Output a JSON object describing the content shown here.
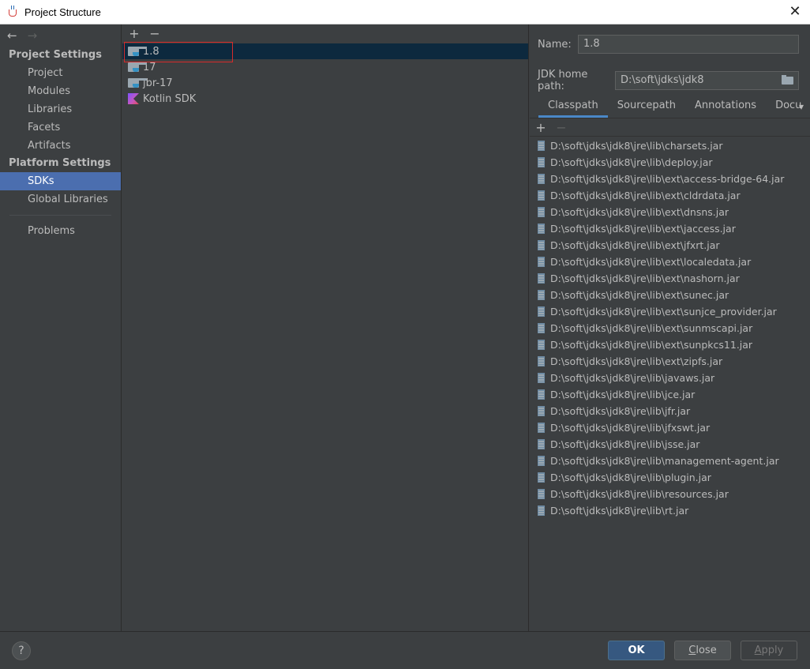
{
  "window": {
    "title": "Project Structure",
    "close_icon": "close-icon"
  },
  "nav": {
    "back_icon": "←",
    "forward_icon": "→",
    "project_settings_title": "Project Settings",
    "platform_settings_title": "Platform Settings",
    "project_items": [
      "Project",
      "Modules",
      "Libraries",
      "Facets",
      "Artifacts"
    ],
    "platform_items": [
      "SDKs",
      "Global Libraries"
    ],
    "other_items": [
      "Problems"
    ],
    "selected": "SDKs"
  },
  "sdk_list": {
    "add_icon": "+",
    "remove_icon": "−",
    "items": [
      {
        "label": "1.8",
        "icon": "jdk-folder-icon",
        "selected": true
      },
      {
        "label": "17",
        "icon": "jdk-folder-icon",
        "selected": false
      },
      {
        "label": "jbr-17",
        "icon": "jdk-folder-icon",
        "selected": false
      },
      {
        "label": "Kotlin SDK",
        "icon": "kotlin-icon",
        "selected": false
      }
    ]
  },
  "details": {
    "name_label": "Name:",
    "name_value": "1.8",
    "home_label": "JDK home path:",
    "home_value": "D:\\soft\\jdks\\jdk8",
    "tabs": [
      "Classpath",
      "Sourcepath",
      "Annotations",
      "Docu"
    ],
    "active_tab": "Classpath",
    "add_icon": "+",
    "remove_icon": "−",
    "classpath": [
      "D:\\soft\\jdks\\jdk8\\jre\\lib\\charsets.jar",
      "D:\\soft\\jdks\\jdk8\\jre\\lib\\deploy.jar",
      "D:\\soft\\jdks\\jdk8\\jre\\lib\\ext\\access-bridge-64.jar",
      "D:\\soft\\jdks\\jdk8\\jre\\lib\\ext\\cldrdata.jar",
      "D:\\soft\\jdks\\jdk8\\jre\\lib\\ext\\dnsns.jar",
      "D:\\soft\\jdks\\jdk8\\jre\\lib\\ext\\jaccess.jar",
      "D:\\soft\\jdks\\jdk8\\jre\\lib\\ext\\jfxrt.jar",
      "D:\\soft\\jdks\\jdk8\\jre\\lib\\ext\\localedata.jar",
      "D:\\soft\\jdks\\jdk8\\jre\\lib\\ext\\nashorn.jar",
      "D:\\soft\\jdks\\jdk8\\jre\\lib\\ext\\sunec.jar",
      "D:\\soft\\jdks\\jdk8\\jre\\lib\\ext\\sunjce_provider.jar",
      "D:\\soft\\jdks\\jdk8\\jre\\lib\\ext\\sunmscapi.jar",
      "D:\\soft\\jdks\\jdk8\\jre\\lib\\ext\\sunpkcs11.jar",
      "D:\\soft\\jdks\\jdk8\\jre\\lib\\ext\\zipfs.jar",
      "D:\\soft\\jdks\\jdk8\\jre\\lib\\javaws.jar",
      "D:\\soft\\jdks\\jdk8\\jre\\lib\\jce.jar",
      "D:\\soft\\jdks\\jdk8\\jre\\lib\\jfr.jar",
      "D:\\soft\\jdks\\jdk8\\jre\\lib\\jfxswt.jar",
      "D:\\soft\\jdks\\jdk8\\jre\\lib\\jsse.jar",
      "D:\\soft\\jdks\\jdk8\\jre\\lib\\management-agent.jar",
      "D:\\soft\\jdks\\jdk8\\jre\\lib\\plugin.jar",
      "D:\\soft\\jdks\\jdk8\\jre\\lib\\resources.jar",
      "D:\\soft\\jdks\\jdk8\\jre\\lib\\rt.jar"
    ]
  },
  "footer": {
    "help_label": "?",
    "ok_label": "OK",
    "close_label": "Close",
    "apply_label": "Apply"
  },
  "colors": {
    "background": "#3c3f41",
    "selection": "#4b6eaf",
    "list_selection": "#0d293e",
    "accent_tab": "#4a88c7",
    "ok_button": "#365880",
    "highlight_box": "#d52b2b"
  }
}
